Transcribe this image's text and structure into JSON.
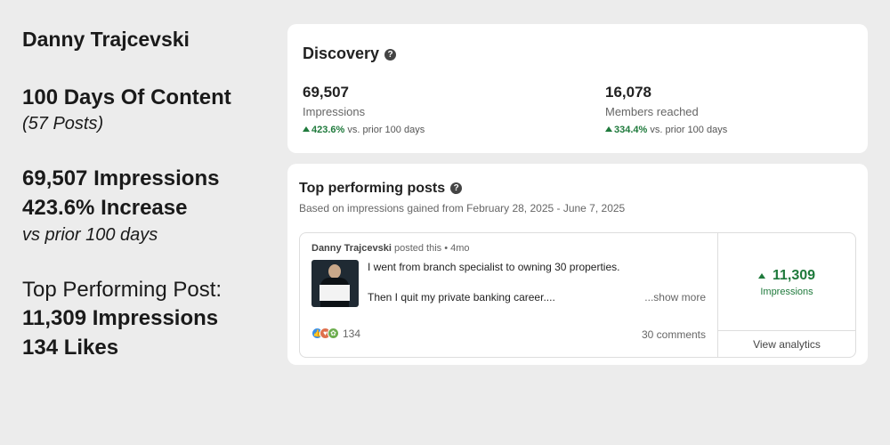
{
  "summary": {
    "name": "Danny Trajcevski",
    "days": "100 Days Of Content",
    "posts": "(57 Posts)",
    "impressions": "69,507 Impressions",
    "increase": "423.6% Increase",
    "prior": "vs prior 100 days",
    "top_post_label": "Top Performing Post:",
    "top_post_impressions": "11,309 Impressions",
    "top_post_likes": "134 Likes"
  },
  "discovery": {
    "title": "Discovery",
    "help_glyph": "?",
    "metrics": [
      {
        "value": "69,507",
        "label": "Impressions",
        "change": "423.6%",
        "change_suffix": "vs. prior 100 days"
      },
      {
        "value": "16,078",
        "label": "Members reached",
        "change": "334.4%",
        "change_suffix": "vs. prior 100 days"
      }
    ]
  },
  "top_posts": {
    "title": "Top performing posts",
    "help_glyph": "?",
    "subtitle": "Based on impressions gained from February 28, 2025 - June 7, 2025",
    "post": {
      "author": "Danny Trajcevski",
      "meta": "posted this • 4mo",
      "line1": "I went from branch specialist to owning 30 properties.",
      "line2": "Then I quit my private banking career....",
      "show_more": "...show more",
      "reaction_count": "134",
      "comments": "30 comments",
      "impressions_value": "11,309",
      "impressions_label": "Impressions",
      "view_analytics": "View analytics"
    }
  },
  "colors": {
    "positive": "#1f7a3c",
    "card": "#ffffff",
    "background": "#ececec"
  }
}
